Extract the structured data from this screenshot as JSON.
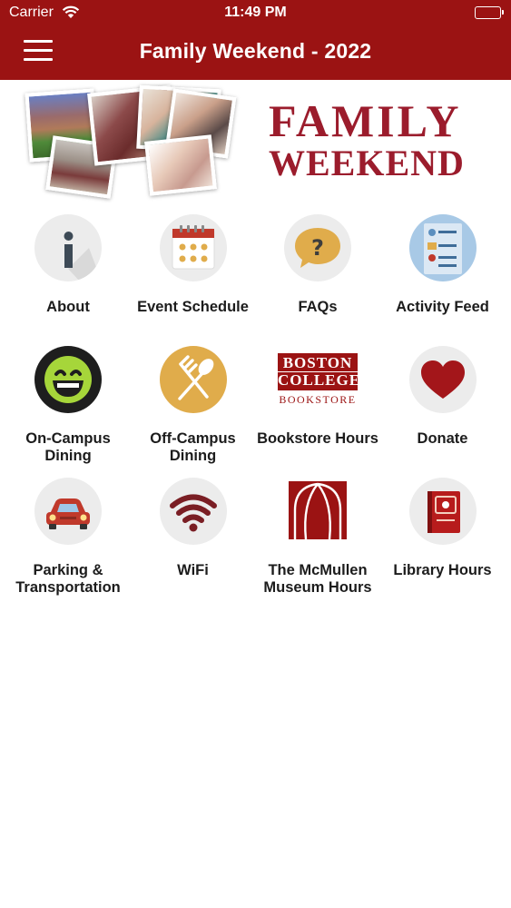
{
  "status_bar": {
    "carrier": "Carrier",
    "time": "11:49 PM"
  },
  "header": {
    "title": "Family Weekend - 2022"
  },
  "banner": {
    "line1": "FAMILY",
    "line2": "WEEKEND"
  },
  "tiles": [
    {
      "label": "About",
      "icon": "info-icon"
    },
    {
      "label": "Event Schedule",
      "icon": "calendar-icon"
    },
    {
      "label": "FAQs",
      "icon": "question-bubble-icon"
    },
    {
      "label": "Activity Feed",
      "icon": "activity-list-icon"
    },
    {
      "label": "On-Campus\nDining",
      "icon": "smiley-icon"
    },
    {
      "label": "Off-Campus\nDining",
      "icon": "fork-spoon-icon"
    },
    {
      "label": "Bookstore Hours",
      "icon": "bookstore-logo-icon",
      "logo_lines": [
        "BOSTON",
        "COLLEGE",
        "BOOKSTORE"
      ]
    },
    {
      "label": "Donate",
      "icon": "heart-icon"
    },
    {
      "label": "Parking &\nTransportation",
      "icon": "car-icon"
    },
    {
      "label": "WiFi",
      "icon": "wifi-icon"
    },
    {
      "label": "The McMullen\nMuseum Hours",
      "icon": "museum-icon"
    },
    {
      "label": "Library Hours",
      "icon": "book-icon"
    }
  ],
  "colors": {
    "brand": "#9b1313",
    "maroon_text": "#9b1c2c",
    "gold": "#e0ac4b",
    "tile_bg": "#ececec"
  }
}
